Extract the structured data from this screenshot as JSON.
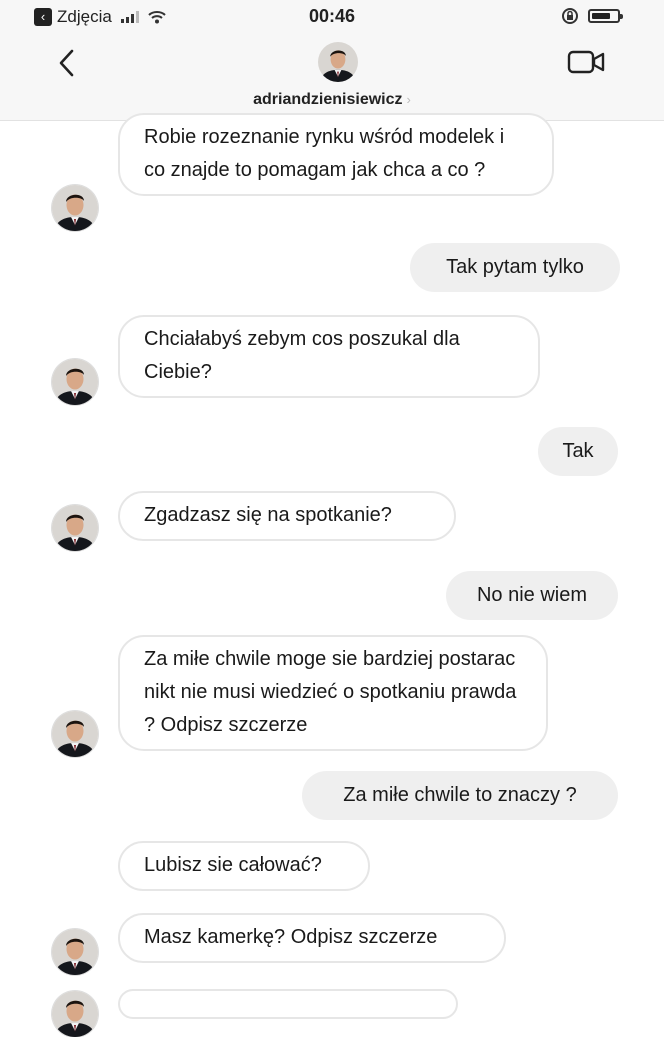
{
  "status_bar": {
    "back_app_label": "Zdjęcia",
    "time": "00:46"
  },
  "header": {
    "username": "adriandzienisiewicz",
    "chevron": "›"
  },
  "messages": [
    {
      "direction": "incoming",
      "text": "Robie rozeznanie rynku wśród modelek i co znajde to pomagam jak chca a co ?"
    },
    {
      "direction": "outgoing",
      "text": "Tak pytam tylko"
    },
    {
      "direction": "incoming",
      "text": "Chciałabyś zebym cos poszukal dla Ciebie?"
    },
    {
      "direction": "outgoing",
      "text": "Tak"
    },
    {
      "direction": "incoming",
      "text": "Zgadzasz się na spotkanie?"
    },
    {
      "direction": "outgoing",
      "text": "No nie wiem"
    },
    {
      "direction": "incoming",
      "text": "Za miłe chwile  moge sie bardziej postarac nikt nie  musi wiedzieć o spotkaniu prawda ? Odpisz szczerze"
    },
    {
      "direction": "outgoing",
      "text": "Za miłe chwile to znaczy ?"
    },
    {
      "direction": "incoming",
      "text": "Lubisz sie całować?"
    },
    {
      "direction": "incoming",
      "text": "Masz kamerkę? Odpisz szczerze"
    }
  ],
  "icons": {
    "back": "chevron-left-icon",
    "video": "video-camera-icon",
    "lock": "orientation-lock-icon",
    "battery": "battery-icon",
    "wifi": "wifi-icon",
    "signal": "signal-icon"
  },
  "colors": {
    "incoming_border": "#e6e6e6",
    "outgoing_fill": "#efefef",
    "header_bg": "#f7f7f7"
  },
  "battery_level": 0.65,
  "signal_bars_active": 3
}
